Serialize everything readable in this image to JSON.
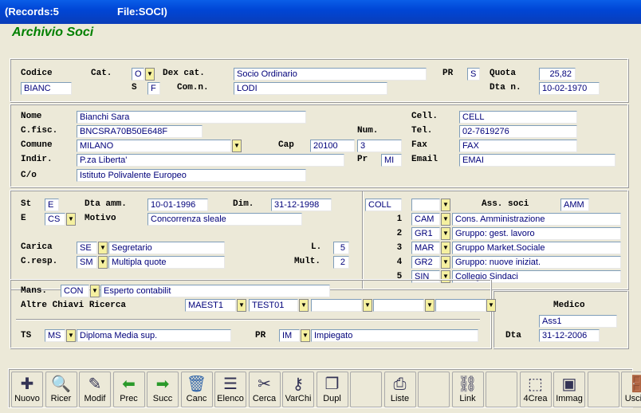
{
  "window": {
    "records": "(Records:5",
    "file": "File:SOCI)"
  },
  "app_title": "Archivio Soci",
  "header": {
    "codice_label": "Codice",
    "codice": "BIANC",
    "cat_label": "Cat.",
    "cat": "O",
    "s_label": "S",
    "s": "F",
    "dexcat_label": "Dex cat.",
    "dexcat": "Socio Ordinario",
    "comn_label": "Com.n.",
    "comn": "LODI",
    "pr_label": "PR",
    "pr": "S",
    "quota_label": "Quota",
    "quota": "25,82",
    "dtan_label": "Dta n.",
    "dtan": "10-02-1970"
  },
  "person": {
    "nome_label": "Nome",
    "nome": "Bianchi Sara",
    "cfisc_label": "C.fisc.",
    "cfisc": "BNCSRA70B50E648F",
    "num_label": "Num.",
    "comune_label": "Comune",
    "comune": "MILANO",
    "cap_label": "Cap",
    "cap": "20100",
    "num": "3",
    "indir_label": "Indir.",
    "indir": "P.za Liberta'",
    "pr_label": "Pr",
    "pr": "MI",
    "co_label": "C/o",
    "co": "Istituto Polivalente Europeo",
    "cell_label": "Cell.",
    "cell": "CELL",
    "tel_label": "Tel.",
    "tel": "02-7619276",
    "fax_label": "Fax",
    "fax": "FAX",
    "email_label": "Email",
    "email": "EMAI"
  },
  "status": {
    "st_label": "St",
    "st": "E",
    "dtaamm_label": "Dta amm.",
    "dtaamm": "10-01-1996",
    "dim_label": "Dim.",
    "dim": "31-12-1998",
    "e_label": "E",
    "e": "CS",
    "motivo_label": "Motivo",
    "motivo": "Concorrenza sleale",
    "carica_label": "Carica",
    "carica": "SE",
    "carica_desc": "Segretario",
    "l_label": "L.",
    "l": "5",
    "cresp_label": "C.resp.",
    "cresp": "SM",
    "cresp_desc": "Multipla quote",
    "mult_label": "Mult.",
    "mult": "2"
  },
  "assoc": {
    "coll": "COLL",
    "ass_label": "Ass. soci",
    "amm": "AMM",
    "rows": [
      {
        "n": "1",
        "code": "CAM",
        "desc": "Cons. Amministrazione"
      },
      {
        "n": "2",
        "code": "GR1",
        "desc": "Gruppo: gest. lavoro"
      },
      {
        "n": "3",
        "code": "MAR",
        "desc": "Gruppo Market.Sociale"
      },
      {
        "n": "4",
        "code": "GR2",
        "desc": "Gruppo: nuove iniziat."
      },
      {
        "n": "5",
        "code": "SIN",
        "desc": "Collegio Sindaci"
      }
    ]
  },
  "mans": {
    "mans_label": "Mans.",
    "mans": "CON",
    "mans_desc": "Esperto contabilit",
    "altre_label": "Altre Chiavi Ricerca",
    "key1": "MAEST1",
    "key2": "TEST01",
    "ts_label": "TS",
    "ts": "MS",
    "ts_desc": "Diploma Media sup.",
    "pr_label": "PR",
    "pr": "IM",
    "pr_desc": "Impiegato"
  },
  "medico": {
    "label": "Medico",
    "ass": "Ass1",
    "dta_label": "Dta",
    "dta": "31-12-2006"
  },
  "toolbar": [
    {
      "label": "Nuovo",
      "icon": "new-icon"
    },
    {
      "label": "Ricer",
      "icon": "search-icon"
    },
    {
      "label": "Modif",
      "icon": "edit-icon"
    },
    {
      "label": "Prec",
      "icon": "arrow-left-icon"
    },
    {
      "label": "Succ",
      "icon": "arrow-right-icon"
    },
    {
      "label": "Canc",
      "icon": "trash-icon"
    },
    {
      "label": "Elenco",
      "icon": "list-icon"
    },
    {
      "label": "Cerca",
      "icon": "find-icon"
    },
    {
      "label": "VarChi",
      "icon": "keys-icon"
    },
    {
      "label": "Dupl",
      "icon": "duplicate-icon"
    },
    {
      "label": "",
      "icon": ""
    },
    {
      "label": "Liste",
      "icon": "printer-icon"
    },
    {
      "label": "",
      "icon": ""
    },
    {
      "label": "Link",
      "icon": "link-icon"
    },
    {
      "label": "",
      "icon": ""
    },
    {
      "label": "4Crea",
      "icon": "create-icon"
    },
    {
      "label": "Immag",
      "icon": "image-icon"
    },
    {
      "label": "",
      "icon": ""
    },
    {
      "label": "Uscita",
      "icon": "exit-icon"
    }
  ]
}
